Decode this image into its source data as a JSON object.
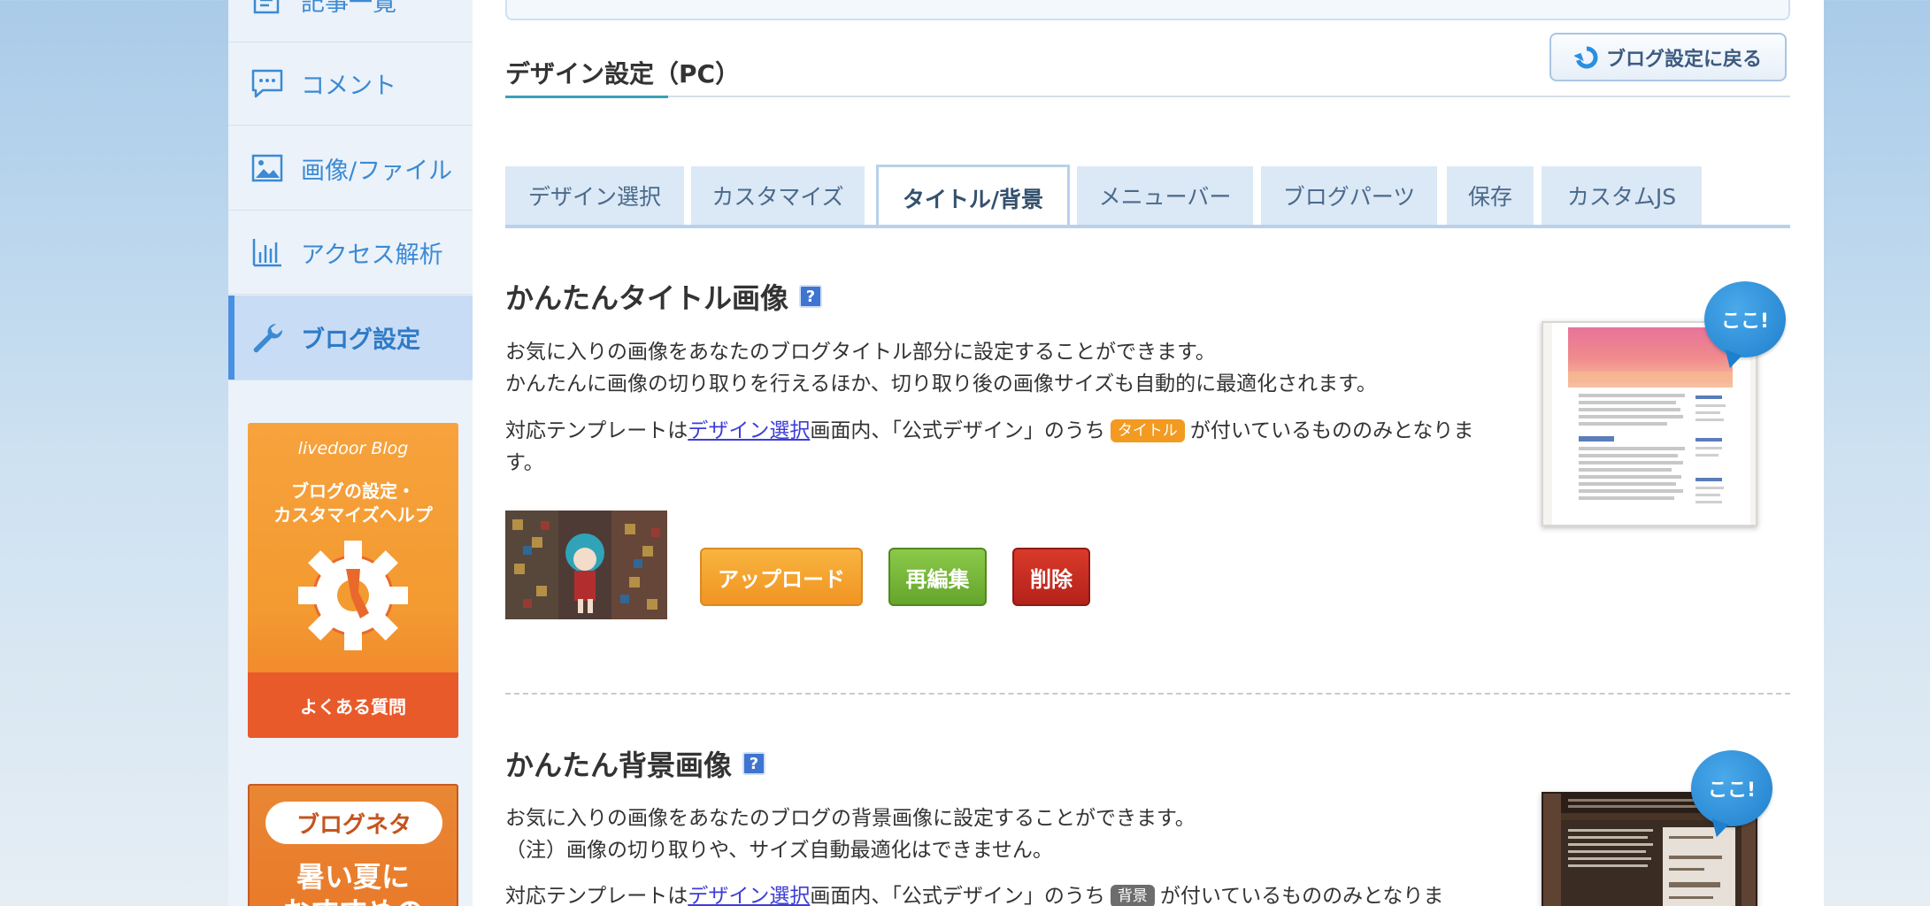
{
  "sidebar": {
    "items": [
      {
        "label": "記事一覧",
        "icon": "document-list-icon"
      },
      {
        "label": "コメント",
        "icon": "comment-icon"
      },
      {
        "label": "画像/ファイル",
        "icon": "image-icon"
      },
      {
        "label": "アクセス解析",
        "icon": "bar-chart-icon"
      },
      {
        "label": "ブログ設定",
        "icon": "wrench-icon",
        "active": true
      }
    ],
    "help_banner": {
      "brand": "livedoor Blog",
      "title_line1": "ブログの設定・",
      "title_line2": "カスタマイズヘルプ",
      "faq": "よくある質問"
    },
    "neta_banner": {
      "pill": "ブログネタ",
      "line1": "暑い夏に",
      "line2": "おすすめの"
    }
  },
  "header": {
    "title": "デザイン設定（PC）",
    "back_button": "ブログ設定に戻る"
  },
  "tabs": [
    {
      "label": "デザイン選択"
    },
    {
      "label": "カスタマイズ"
    },
    {
      "label": "タイトル/背景",
      "active": true
    },
    {
      "label": "メニューバー"
    },
    {
      "label": "ブログパーツ"
    },
    {
      "label": "保存"
    },
    {
      "label": "カスタムJS"
    }
  ],
  "title_section": {
    "heading": "かんたんタイトル画像",
    "help": "?",
    "desc1": "お気に入りの画像をあなたのブログタイトル部分に設定することができます。",
    "desc2": "かんたんに画像の切り取りを行えるほか、切り取り後の画像サイズも自動的に最適化されます。",
    "tpl_prefix": "対応テンプレートは",
    "tpl_link": "デザイン選択",
    "tpl_mid": "画面内、「公式デザイン」のうち",
    "tpl_tag": "タイトル",
    "tpl_suffix": "が付いているもののみとなりま",
    "tpl_suffix2": "す。",
    "buttons": {
      "upload": "アップロード",
      "reedit": "再編集",
      "delete": "削除"
    },
    "koko": "ここ!"
  },
  "bg_section": {
    "heading": "かんたん背景画像",
    "help": "?",
    "desc1": "お気に入りの画像をあなたのブログの背景画像に設定することができます。",
    "desc2": "（注）画像の切り取りや、サイズ自動最適化はできません。",
    "tpl_prefix": "対応テンプレートは",
    "tpl_link": "デザイン選択",
    "tpl_mid": "画面内、「公式デザイン」のうち",
    "tpl_tag": "背景",
    "tpl_suffix": "が付いているもののみとなりま",
    "koko": "ここ!"
  },
  "colors": {
    "accent_blue": "#3b8ad3",
    "upload_orange": "#f19422",
    "reedit_green": "#64a52b",
    "delete_red": "#b4211a"
  }
}
